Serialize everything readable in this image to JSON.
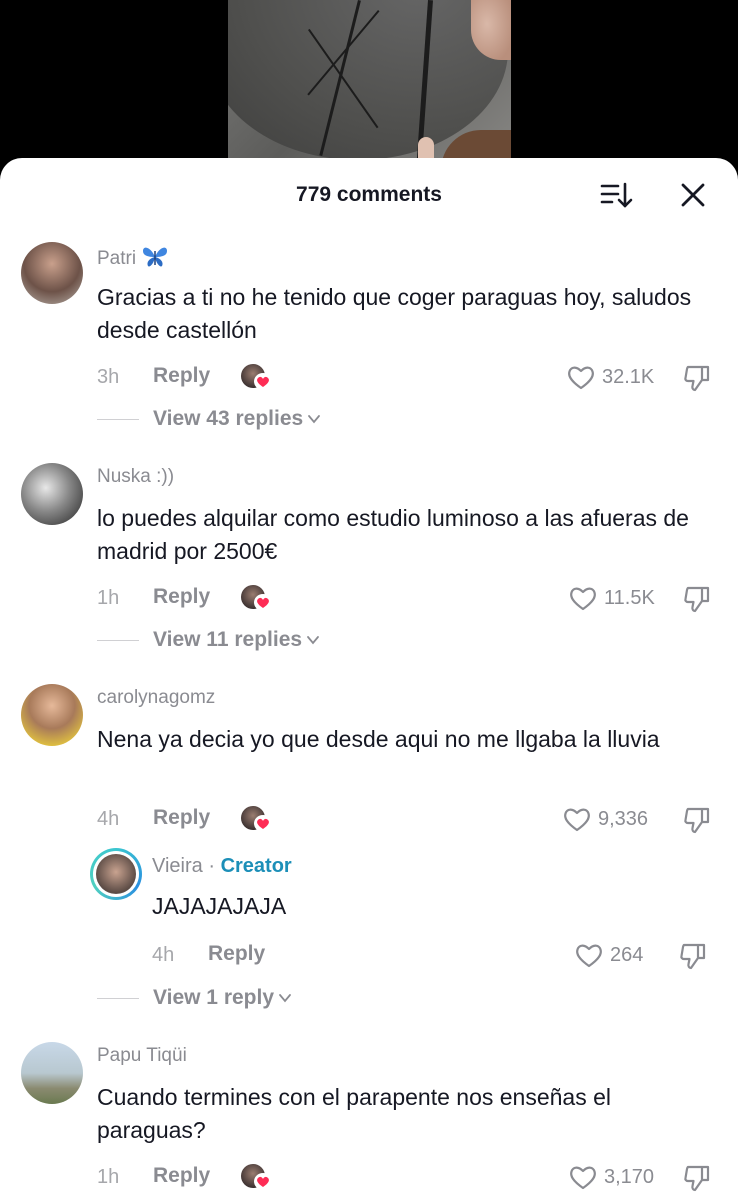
{
  "header": {
    "title": "779 comments"
  },
  "comments": [
    {
      "author": "Patri",
      "author_emoji": "🦋",
      "text": "Gracias a ti no he tenido que coger paraguas hoy, saludos desde castellón",
      "time": "3h",
      "reply_label": "Reply",
      "likes": "32.1K",
      "view_replies": "View 43 replies"
    },
    {
      "author": "Nuska :))",
      "text": "lo puedes alquilar como estudio luminoso a las afueras de madrid por 2500€",
      "time": "1h",
      "reply_label": "Reply",
      "likes": "11.5K",
      "view_replies": "View 11 replies"
    },
    {
      "author": "carolynagomz",
      "text": "Nena ya decia yo que desde aqui no me llgaba la lluvia",
      "time": "4h",
      "reply_label": "Reply",
      "likes": "9,336",
      "reply": {
        "author": "Vieira",
        "separator": " · ",
        "badge": "Creator",
        "text": "JAJAJAJAJA",
        "time": "4h",
        "reply_label": "Reply",
        "likes": "264"
      },
      "view_replies": "View 1 reply"
    },
    {
      "author": "Papu Tiqüi",
      "text": "Cuando termines con el parapente nos enseñas el paraguas?",
      "time": "1h",
      "reply_label": "Reply",
      "likes": "3,170"
    }
  ],
  "colors": {
    "creator_badge": "#1c8fb8",
    "liked_heart": "#fe2c55",
    "text": "#161823",
    "muted": "#8a8b91"
  }
}
